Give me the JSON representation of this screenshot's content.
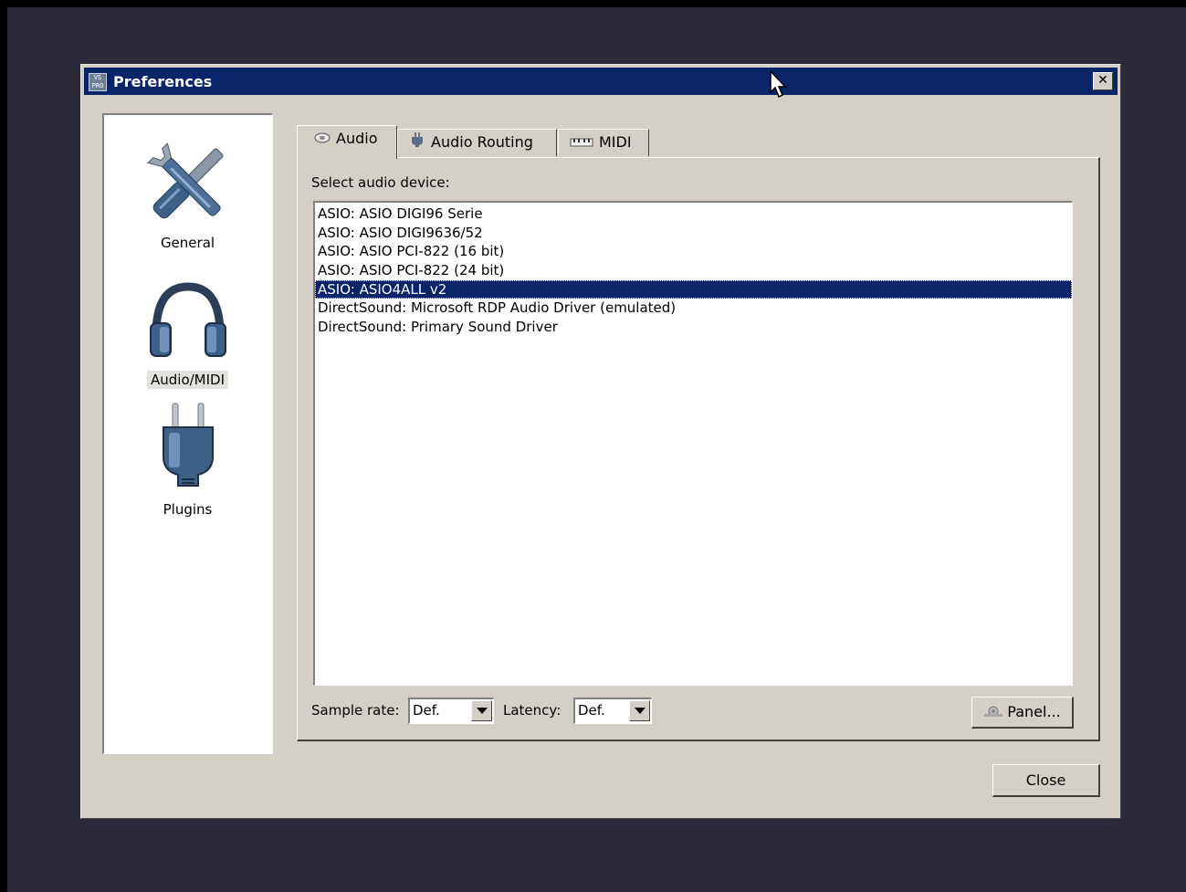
{
  "window": {
    "title": "Preferences",
    "icon_label": "VS PRO",
    "close_glyph": "✕"
  },
  "sidebar": {
    "items": [
      {
        "label": "General",
        "icon": "wrench-screwdriver-icon"
      },
      {
        "label": "Audio/MIDI",
        "icon": "headphones-icon",
        "selected": true
      },
      {
        "label": "Plugins",
        "icon": "power-plug-icon"
      }
    ]
  },
  "tabs": [
    {
      "label": "Audio",
      "icon": "disc-icon",
      "active": true
    },
    {
      "label": "Audio Routing",
      "icon": "plug-icon"
    },
    {
      "label": "MIDI",
      "icon": "midi-keyboard-icon"
    }
  ],
  "audio": {
    "select_label": "Select audio device:",
    "devices": [
      "ASIO: ASIO DIGI96 Serie",
      "ASIO: ASIO DIGI9636/52",
      "ASIO: ASIO PCI-822 (16 bit)",
      "ASIO: ASIO PCI-822 (24 bit)",
      "ASIO: ASIO4ALL v2",
      "DirectSound: Microsoft RDP Audio Driver (emulated)",
      "DirectSound: Primary Sound Driver"
    ],
    "selected_device": "ASIO: ASIO4ALL v2",
    "sample_rate_label": "Sample rate:",
    "sample_rate_value": "Def.",
    "latency_label": "Latency:",
    "latency_value": "Def.",
    "panel_button": "Panel..."
  },
  "footer": {
    "close_button": "Close"
  },
  "colors": {
    "titlebar": "#0a246a",
    "selection": "#0a246a",
    "face": "#d4d0c8",
    "desktop": "#2b2a39"
  }
}
